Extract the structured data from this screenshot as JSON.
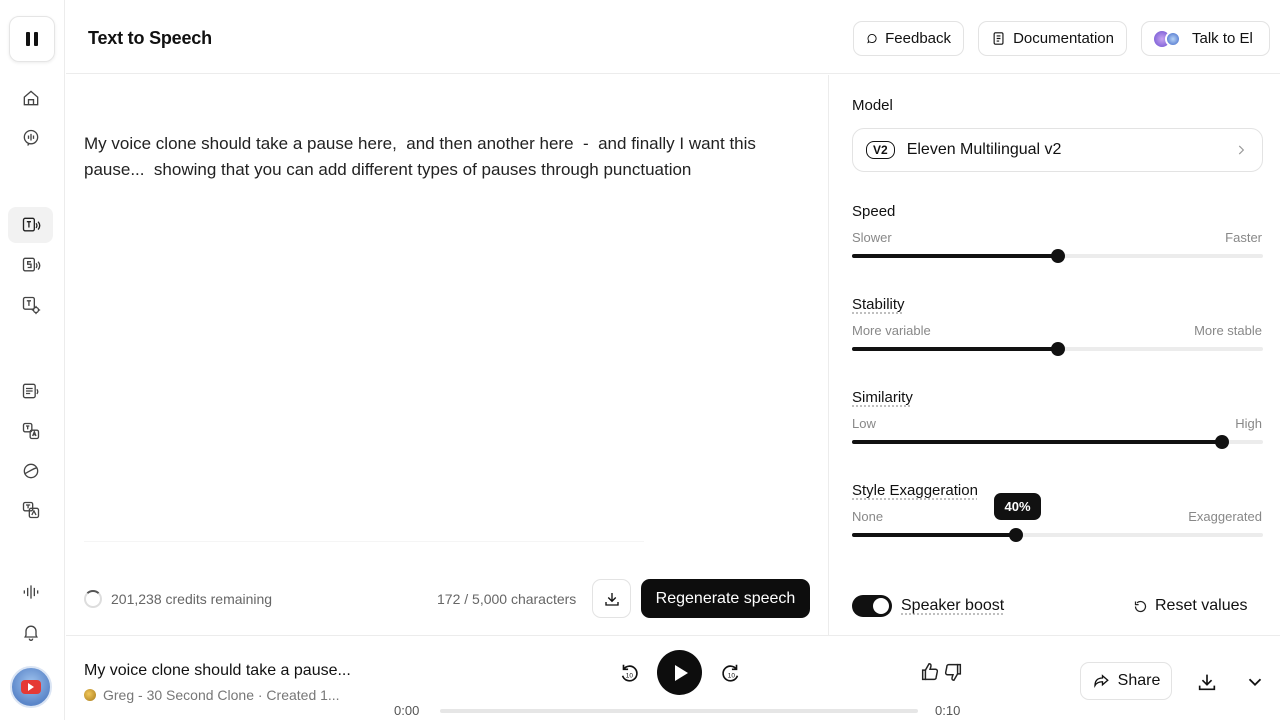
{
  "header": {
    "title": "Text to Speech",
    "feedback_label": "Feedback",
    "documentation_label": "Documentation",
    "talk_label": "Talk to El"
  },
  "sidebar": {
    "items": [
      {
        "name": "home",
        "icon": "home-icon"
      },
      {
        "name": "voices",
        "icon": "speech-bubble-icon"
      },
      {
        "name": "text-to-speech",
        "icon": "text-speech-icon",
        "active": true
      },
      {
        "name": "speech-to-speech",
        "icon": "speech-to-speech-icon"
      },
      {
        "name": "sound-effects",
        "icon": "text-settings-icon"
      },
      {
        "name": "projects",
        "icon": "document-audio-icon"
      },
      {
        "name": "dubbing",
        "icon": "translate-icon"
      },
      {
        "name": "voice-isolator",
        "icon": "check-circle-icon"
      },
      {
        "name": "translate",
        "icon": "text-translate-icon"
      },
      {
        "name": "waveform",
        "icon": "waveform-icon"
      },
      {
        "name": "notifications",
        "icon": "bell-icon"
      }
    ]
  },
  "editor": {
    "text": "My voice clone should take a pause here,  and then another here  -  and finally I want this pause...  showing that you can add different types of pauses through punctuation",
    "credits": "201,238 credits remaining",
    "char_count": "172 / 5,000 characters",
    "regenerate_label": "Regenerate speech"
  },
  "settings": {
    "model_label": "Model",
    "model_badge": "V2",
    "model_name": "Eleven Multilingual v2",
    "speed": {
      "label": "Speed",
      "min_label": "Slower",
      "max_label": "Faster",
      "value": 0.5
    },
    "stability": {
      "label": "Stability",
      "min_label": "More variable",
      "max_label": "More stable",
      "value": 0.5
    },
    "similarity": {
      "label": "Similarity",
      "min_label": "Low",
      "max_label": "High",
      "value": 0.9
    },
    "style": {
      "label": "Style Exaggeration",
      "min_label": "None",
      "max_label": "Exaggerated",
      "value": 0.4,
      "tooltip": "40%"
    },
    "speaker_boost_label": "Speaker boost",
    "speaker_boost_on": true,
    "reset_label": "Reset values"
  },
  "player": {
    "title": "My voice clone should take a pause...",
    "meta": "Greg - 30 Second Clone · Created 1...",
    "current_time": "0:00",
    "total_time": "0:10",
    "skip_seconds": "10",
    "share_label": "Share",
    "progress": 0
  }
}
